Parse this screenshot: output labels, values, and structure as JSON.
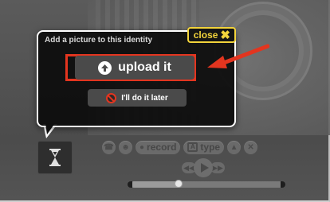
{
  "popup": {
    "title": "Add a picture to this identity",
    "close_label": "close",
    "upload_label": "upload it",
    "later_label": "I'll do it later"
  },
  "controls": {
    "record_label": "record",
    "type_label": "type",
    "type_box_glyph": "A"
  },
  "playback": {
    "progress": 0.31
  },
  "colors": {
    "accent_yellow": "#f3d43b",
    "highlight_red": "#e3351f",
    "popup_bg": "#0c0c0c",
    "button_gray": "#4a4a4a"
  }
}
